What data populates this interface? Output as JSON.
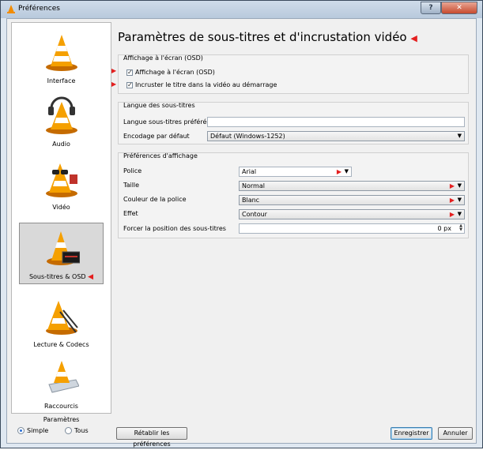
{
  "window": {
    "title": "Préférences"
  },
  "categories": [
    {
      "label": "Interface",
      "icon": "cone-icon"
    },
    {
      "label": "Audio",
      "icon": "cone-headphones-icon"
    },
    {
      "label": "Vidéo",
      "icon": "cone-glasses-icon"
    },
    {
      "label": "Sous-titres & OSD",
      "icon": "cone-subtitle-icon",
      "selected": true
    },
    {
      "label": "Lecture & Codecs",
      "icon": "cone-cables-icon"
    },
    {
      "label": "Raccourcis",
      "icon": "cone-keyboard-icon"
    }
  ],
  "mode": {
    "title": "Paramètres",
    "simple": "Simple",
    "all": "Tous",
    "selected": "simple"
  },
  "main": {
    "title": "Paramètres de sous-titres et d'incrustation vidéo",
    "osd_group": {
      "title": "Affichage à l'écran (OSD)",
      "enable_osd": "Affichage à l'écran (OSD)",
      "show_title": "Incruster le titre dans la vidéo au démarrage"
    },
    "lang_group": {
      "title": "Langue des sous-titres",
      "preferred_label": "Langue sous-titres préférée",
      "preferred_value": "",
      "encoding_label": "Encodage par défaut",
      "encoding_value": "Défaut (Windows-1252)"
    },
    "display_group": {
      "title": "Préférences d'affichage",
      "font_label": "Police",
      "font_value": "Arial",
      "size_label": "Taille",
      "size_value": "Normal",
      "color_label": "Couleur de la police",
      "color_value": "Blanc",
      "effect_label": "Effet",
      "effect_value": "Contour",
      "position_label": "Forcer la position des sous-titres",
      "position_value": "0 px"
    }
  },
  "buttons": {
    "reset": "Rétablir les préférences",
    "save": "Enregistrer",
    "cancel": "Annuler"
  },
  "colors": {
    "accent_arrow": "#e41f1f",
    "selection": "#d9d9d9"
  }
}
